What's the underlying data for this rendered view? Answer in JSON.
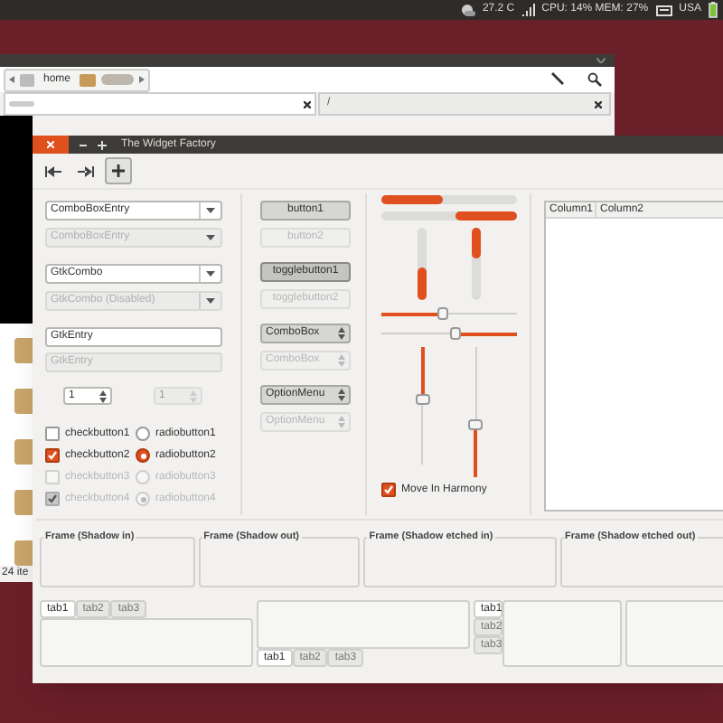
{
  "top_panel": {
    "temperature": "27.2 C",
    "system_monitor": "CPU: 14% MEM: 27%",
    "keyboard_layout": "USA"
  },
  "file_manager": {
    "path_buttons": [
      "home"
    ],
    "location_tab": "/",
    "status": "24 ite"
  },
  "widget_factory": {
    "title": "The Widget Factory",
    "toolbar": [
      {
        "kind": "first",
        "pressed": false
      },
      {
        "kind": "last",
        "pressed": false
      },
      {
        "kind": "add",
        "pressed": true
      }
    ],
    "text_widgets": [
      {
        "kind": "combo_entry",
        "text": "ComboBoxEntry",
        "disabled": false
      },
      {
        "kind": "combo_entry",
        "text": "ComboBoxEntry",
        "disabled": true
      },
      {
        "kind": "combo",
        "text": "GtkCombo",
        "disabled": false
      },
      {
        "kind": "combo",
        "text": "GtkCombo (Disabled)",
        "disabled": true
      },
      {
        "kind": "entry",
        "text": "GtkEntry",
        "disabled": false
      },
      {
        "kind": "entry",
        "text": "GtkEntry",
        "disabled": true
      }
    ],
    "spin_buttons": [
      {
        "value": "1",
        "disabled": false
      },
      {
        "value": "1",
        "disabled": true
      }
    ],
    "check_buttons": [
      {
        "label": "checkbutton1",
        "checked": false,
        "disabled": false
      },
      {
        "label": "checkbutton2",
        "checked": true,
        "disabled": false
      },
      {
        "label": "checkbutton3",
        "checked": false,
        "disabled": true
      },
      {
        "label": "checkbutton4",
        "checked": true,
        "disabled": true
      }
    ],
    "radio_buttons": [
      {
        "label": "radiobutton1",
        "selected": false,
        "disabled": false
      },
      {
        "label": "radiobutton2",
        "selected": true,
        "disabled": false
      },
      {
        "label": "radiobutton3",
        "selected": false,
        "disabled": true
      },
      {
        "label": "radiobutton4",
        "selected": true,
        "disabled": true
      }
    ],
    "buttons": [
      {
        "kind": "button",
        "label": "button1",
        "disabled": false
      },
      {
        "kind": "button",
        "label": "button2",
        "disabled": true
      },
      {
        "kind": "toggle",
        "label": "togglebutton1",
        "disabled": false,
        "active": true
      },
      {
        "kind": "toggle",
        "label": "togglebutton2",
        "disabled": true,
        "active": false
      },
      {
        "kind": "combo_box",
        "label": "ComboBox",
        "disabled": false
      },
      {
        "kind": "combo_box",
        "label": "ComboBox",
        "disabled": true
      },
      {
        "kind": "option_menu",
        "label": "OptionMenu",
        "disabled": false
      },
      {
        "kind": "option_menu",
        "label": "OptionMenu",
        "disabled": true
      }
    ],
    "horizontal_progress_bars": [
      {
        "level": 0.45,
        "kind": "normal"
      },
      {
        "level": 0.45,
        "kind": "inverted"
      }
    ],
    "vertical_progress_bars": [
      {
        "level": 0.45,
        "kind": "normal"
      },
      {
        "level": 0.42,
        "kind": "inverted"
      }
    ],
    "horizontal_scales": [
      {
        "level": 0.45,
        "kind": "normal"
      },
      {
        "level": 0.45,
        "kind": "inverted"
      }
    ],
    "vertical_scales": [
      {
        "level": 0.45,
        "kind": "inverted"
      },
      {
        "level": 0.4,
        "kind": "normal"
      }
    ],
    "move_in_harmony": {
      "label": "Move In Harmony",
      "checked": true
    },
    "tree_view": {
      "columns": [
        "Column1",
        "Column2"
      ]
    },
    "frames": [
      "Frame (Shadow in)",
      "Frame (Shadow out)",
      "Frame (Shadow etched in)",
      "Frame (Shadow etched out)"
    ],
    "notebooks": [
      {
        "kind": "top",
        "tabs": [
          {
            "label": "tab1",
            "selected": true
          },
          {
            "label": "tab2",
            "selected": false
          },
          {
            "label": "tab3",
            "selected": false
          }
        ]
      },
      {
        "kind": "bottom",
        "tabs": [
          {
            "label": "tab1",
            "selected": true
          },
          {
            "label": "tab2",
            "selected": false
          },
          {
            "label": "tab3",
            "selected": false
          }
        ]
      },
      {
        "kind": "left",
        "tabs": [
          {
            "label": "tab1",
            "selected": true
          },
          {
            "label": "tab2",
            "selected": false
          },
          {
            "label": "tab3",
            "selected": false
          }
        ]
      },
      {
        "kind": "right"
      }
    ]
  }
}
